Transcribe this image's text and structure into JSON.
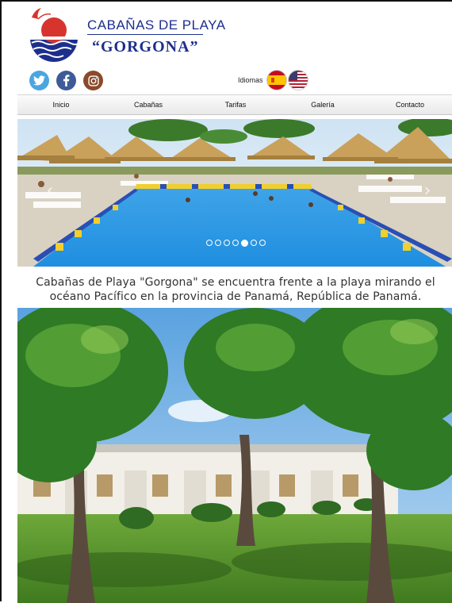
{
  "brand": {
    "line1": "CABAÑAS DE PLAYA",
    "line2": "“GORGONA”",
    "colors": {
      "primary": "#1d2f8c",
      "accent": "#d8342e"
    }
  },
  "social": [
    {
      "name": "twitter",
      "glyph": "t",
      "color": "#4aa6e0"
    },
    {
      "name": "facebook",
      "glyph": "f",
      "color": "#3e5a98"
    },
    {
      "name": "instagram",
      "glyph": "◎",
      "color": "#8a4a2b"
    }
  ],
  "language": {
    "label": "Idiomas",
    "flags": [
      "spanish-flag-icon",
      "us-flag-icon"
    ]
  },
  "nav": {
    "items": [
      "Inicio",
      "Cabañas",
      "Tarifas",
      "Galería",
      "Contacto"
    ]
  },
  "slider": {
    "prev_icon": "‹",
    "next_icon": "›",
    "slide_count": 7,
    "active_index": 4
  },
  "intro": {
    "text": "Cabañas de Playa \"Gorgona\" se encuentra frente a la playa mirando el océano Pacífico en la provincia de Panamá, República de Panamá."
  }
}
